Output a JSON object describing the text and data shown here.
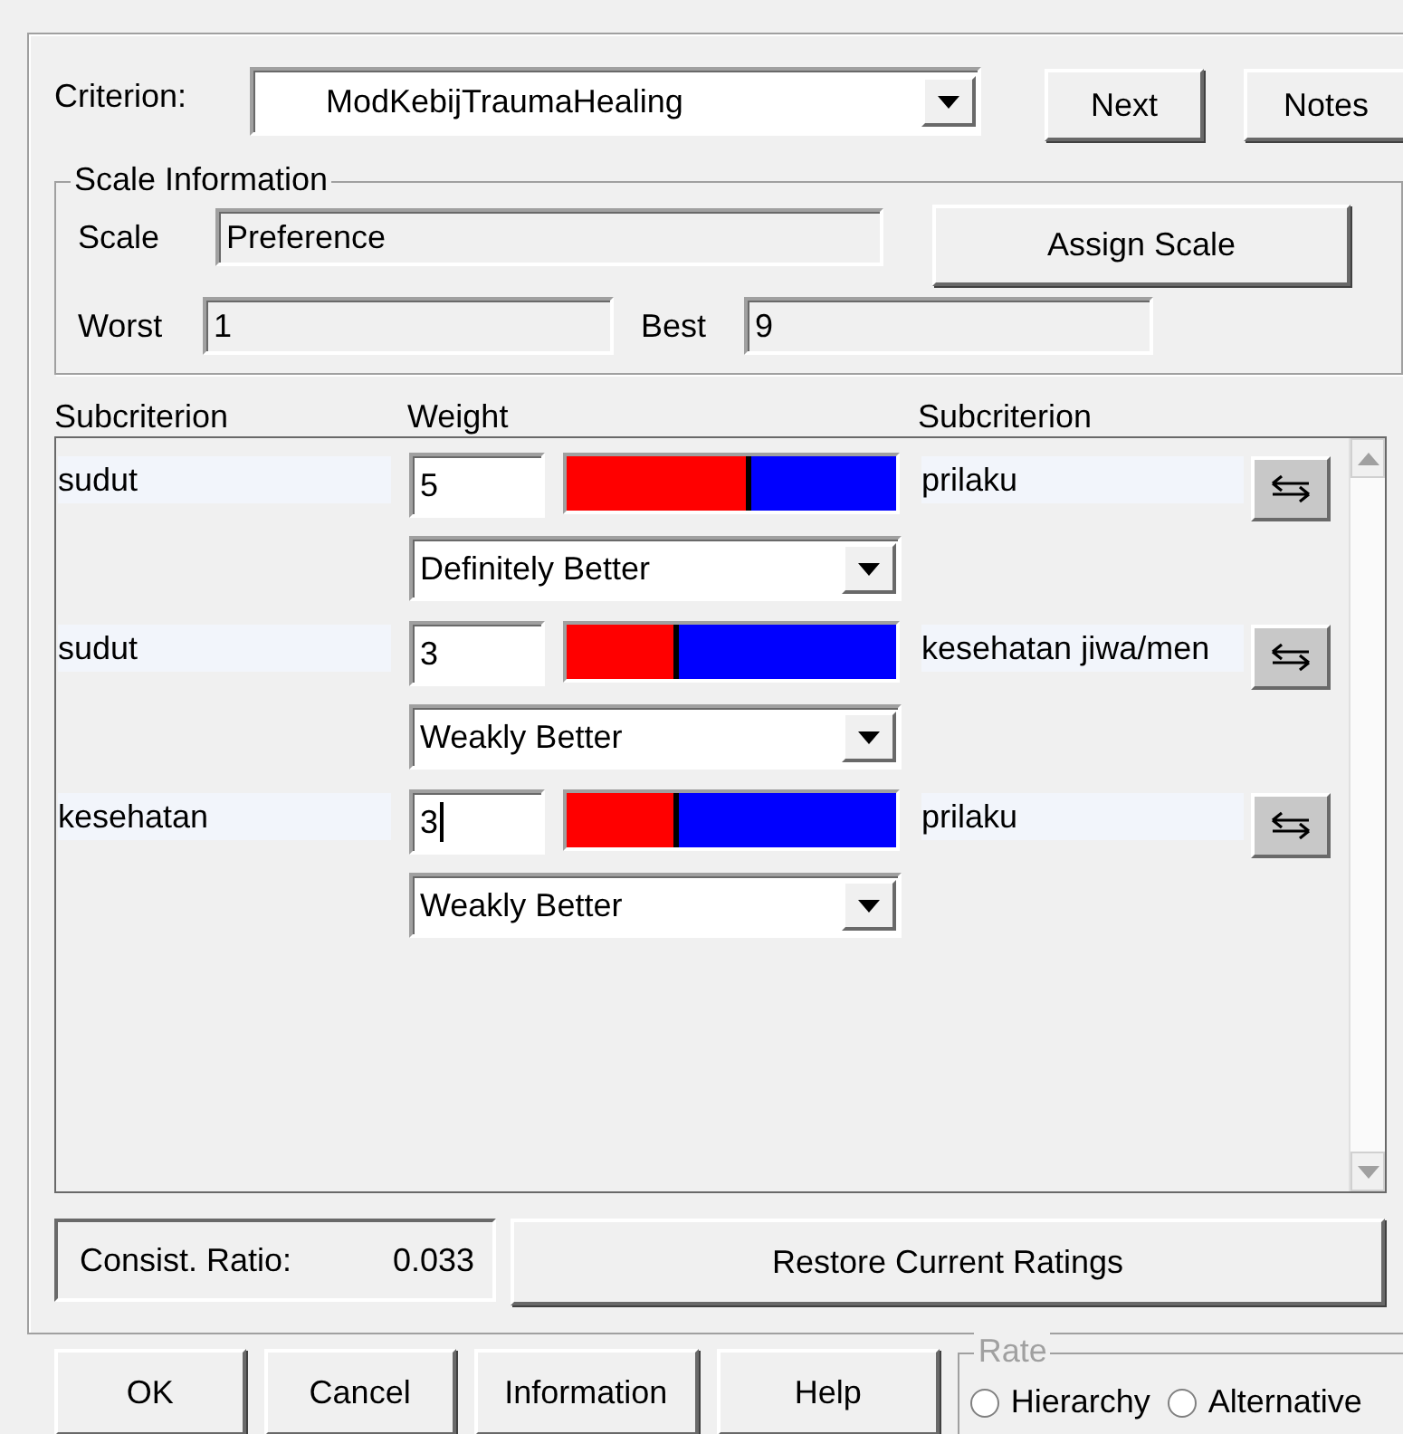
{
  "criterion": {
    "label": "Criterion:",
    "value": "ModKebijTraumaHealing"
  },
  "buttons_top": [
    "Next",
    "Notes"
  ],
  "scale_info": {
    "title": "Scale Information",
    "scale_label": "Scale",
    "scale_value": "Preference",
    "assign_button": "Assign Scale",
    "worst_label": "Worst",
    "worst_value": "1",
    "best_label": "Best",
    "best_value": "9"
  },
  "columns": [
    "Subcriterion",
    "Weight",
    "Subcriterion"
  ],
  "comparisons": [
    {
      "left": "sudut",
      "weight": "5",
      "level": 0.56,
      "right": "prilaku",
      "verbal": "Definitely Better"
    },
    {
      "left": "sudut",
      "weight": "3",
      "level": 0.34,
      "right": "kesehatan jiwa/men",
      "verbal": "Weakly Better"
    },
    {
      "left": "kesehatan",
      "weight": "3",
      "level": 0.34,
      "right": "prilaku",
      "verbal": "Weakly Better",
      "focused": true
    }
  ],
  "consistency": {
    "label": "Consist. Ratio:",
    "value": "0.033"
  },
  "restore_button": "Restore Current Ratings",
  "buttons_bottom": [
    "OK",
    "Cancel",
    "Information",
    "Help"
  ],
  "rate": {
    "title": "Rate",
    "options": [
      {
        "label": "Hierarchy",
        "selected": false
      },
      {
        "label": "Alternative",
        "selected": false
      }
    ]
  }
}
